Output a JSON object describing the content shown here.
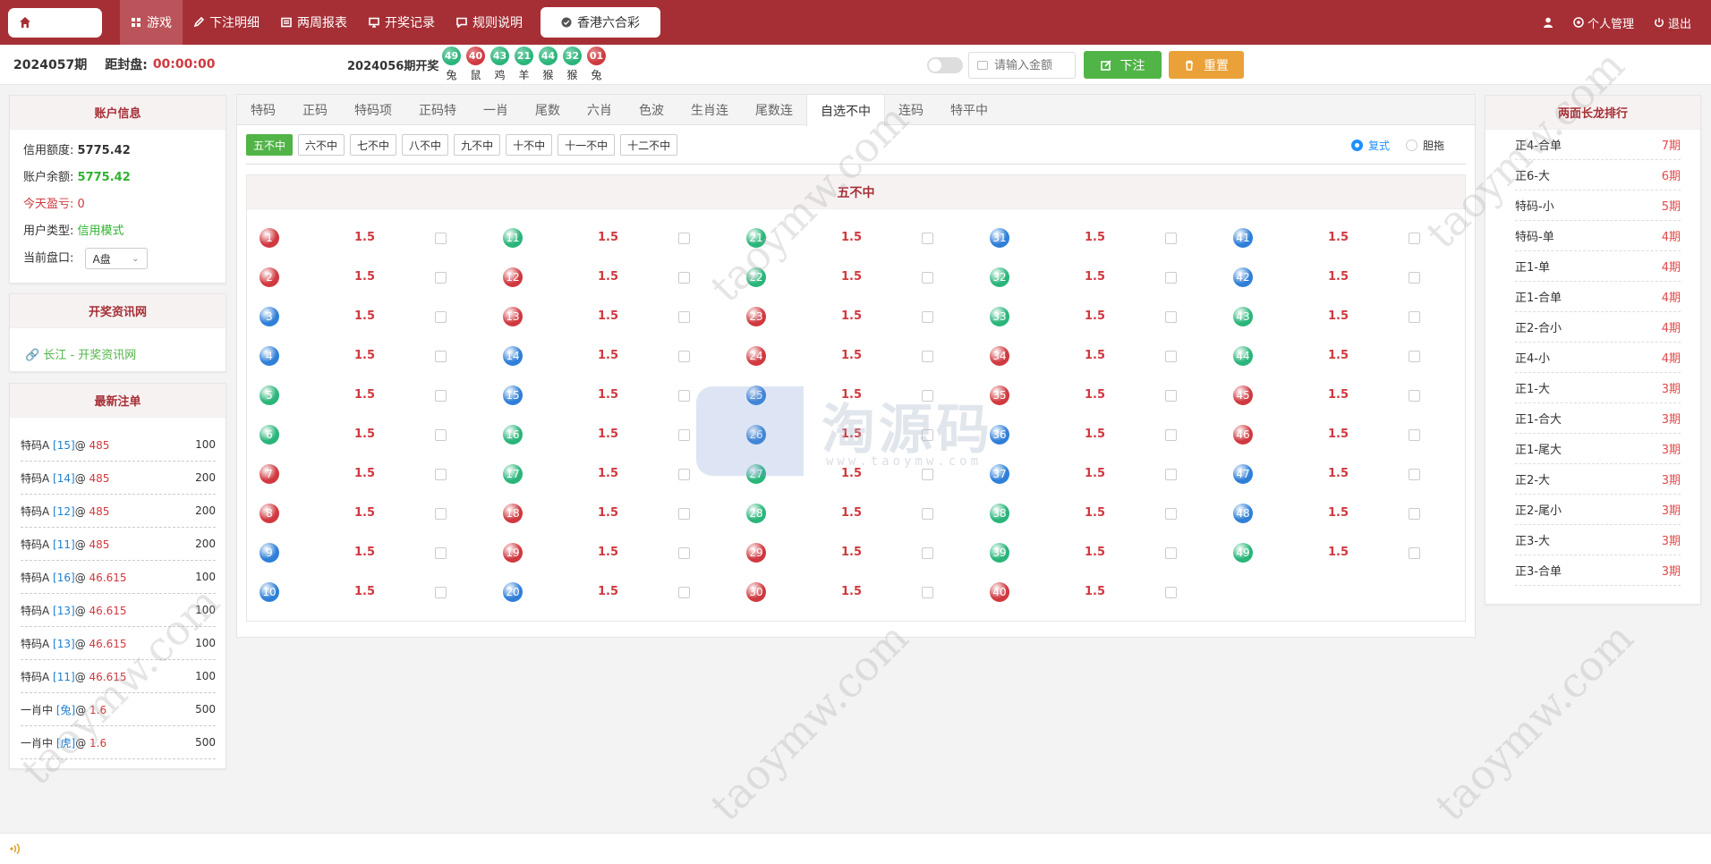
{
  "nav": {
    "items": [
      {
        "label": "游戏",
        "icon": "grid-icon",
        "active": true
      },
      {
        "label": "下注明细",
        "icon": "edit-icon"
      },
      {
        "label": "两周报表",
        "icon": "list-icon"
      },
      {
        "label": "开奖记录",
        "icon": "monitor-icon"
      },
      {
        "label": "规则说明",
        "icon": "message-icon"
      }
    ],
    "lottery": "香港六合彩",
    "user_menu": "个人管理",
    "logout": "退出"
  },
  "infobar": {
    "period": "2024057期",
    "close_label": "距封盘:",
    "close_time": "00:00:00",
    "draw_label": "2024056期开奖",
    "draw_balls": [
      {
        "num": "49",
        "zodiac": "兔",
        "color": "#2ab57a"
      },
      {
        "num": "40",
        "zodiac": "鼠",
        "color": "#d0393f"
      },
      {
        "num": "43",
        "zodiac": "鸡",
        "color": "#2ab57a"
      },
      {
        "num": "21",
        "zodiac": "羊",
        "color": "#2ab57a"
      },
      {
        "num": "44",
        "zodiac": "猴",
        "color": "#2ab57a"
      },
      {
        "num": "32",
        "zodiac": "猴",
        "color": "#2ab57a"
      },
      {
        "num": "01",
        "zodiac": "兔",
        "color": "#d0393f"
      }
    ],
    "amount_placeholder": "请输入金额",
    "bet_button": "下注",
    "reset_button": "重置"
  },
  "account": {
    "title": "账户信息",
    "credit_label": "信用额度:",
    "credit_value": "5775.42",
    "balance_label": "账户余额:",
    "balance_value": "5775.42",
    "profit_label": "今天盈亏:",
    "profit_value": "0",
    "type_label": "用户类型:",
    "type_value": "信用模式",
    "market_label": "当前盘口:",
    "market_value": "A盘"
  },
  "news": {
    "title": "开奖资讯网",
    "link": "长江 - 开奖资讯网"
  },
  "latest": {
    "title": "最新注单",
    "rows": [
      {
        "name": "特码A",
        "sel": "[15]",
        "odds": "485",
        "amount": "100"
      },
      {
        "name": "特码A",
        "sel": "[14]",
        "odds": "485",
        "amount": "200"
      },
      {
        "name": "特码A",
        "sel": "[12]",
        "odds": "485",
        "amount": "200"
      },
      {
        "name": "特码A",
        "sel": "[11]",
        "odds": "485",
        "amount": "200"
      },
      {
        "name": "特码A",
        "sel": "[16]",
        "odds": "46.615",
        "amount": "100"
      },
      {
        "name": "特码A",
        "sel": "[13]",
        "odds": "46.615",
        "amount": "100"
      },
      {
        "name": "特码A",
        "sel": "[13]",
        "odds": "46.615",
        "amount": "100"
      },
      {
        "name": "特码A",
        "sel": "[11]",
        "odds": "46.615",
        "amount": "100"
      },
      {
        "name": "一肖中",
        "sel": "[兔]",
        "odds": "1.6",
        "amount": "500"
      },
      {
        "name": "一肖中",
        "sel": "[虎]",
        "odds": "1.6",
        "amount": "500"
      }
    ]
  },
  "tabs": [
    "特码",
    "正码",
    "特码项",
    "正码特",
    "一肖",
    "尾数",
    "六肖",
    "色波",
    "生肖连",
    "尾数连",
    "自选不中",
    "连码",
    "特平中"
  ],
  "active_tab": 10,
  "subtabs": [
    "五不中",
    "六不中",
    "七不中",
    "八不中",
    "九不中",
    "十不中",
    "十一不中",
    "十二不中"
  ],
  "active_subtab": 0,
  "radio": {
    "compound": "复式",
    "drag": "胆拖"
  },
  "grid": {
    "title": "五不中",
    "odds": "1.5",
    "colors": {
      "red": "#d0393f",
      "blue": "#2f7fd8",
      "green": "#2ab57a"
    },
    "balls": [
      {
        "n": "1",
        "c": "red"
      },
      {
        "n": "2",
        "c": "red"
      },
      {
        "n": "3",
        "c": "blue"
      },
      {
        "n": "4",
        "c": "blue"
      },
      {
        "n": "5",
        "c": "green"
      },
      {
        "n": "6",
        "c": "green"
      },
      {
        "n": "7",
        "c": "red"
      },
      {
        "n": "8",
        "c": "red"
      },
      {
        "n": "9",
        "c": "blue"
      },
      {
        "n": "10",
        "c": "blue"
      },
      {
        "n": "11",
        "c": "green"
      },
      {
        "n": "12",
        "c": "red"
      },
      {
        "n": "13",
        "c": "red"
      },
      {
        "n": "14",
        "c": "blue"
      },
      {
        "n": "15",
        "c": "blue"
      },
      {
        "n": "16",
        "c": "green"
      },
      {
        "n": "17",
        "c": "green"
      },
      {
        "n": "18",
        "c": "red"
      },
      {
        "n": "19",
        "c": "red"
      },
      {
        "n": "20",
        "c": "blue"
      },
      {
        "n": "21",
        "c": "green"
      },
      {
        "n": "22",
        "c": "green"
      },
      {
        "n": "23",
        "c": "red"
      },
      {
        "n": "24",
        "c": "red"
      },
      {
        "n": "25",
        "c": "blue"
      },
      {
        "n": "26",
        "c": "blue"
      },
      {
        "n": "27",
        "c": "green"
      },
      {
        "n": "28",
        "c": "green"
      },
      {
        "n": "29",
        "c": "red"
      },
      {
        "n": "30",
        "c": "red"
      },
      {
        "n": "31",
        "c": "blue"
      },
      {
        "n": "32",
        "c": "green"
      },
      {
        "n": "33",
        "c": "green"
      },
      {
        "n": "34",
        "c": "red"
      },
      {
        "n": "35",
        "c": "red"
      },
      {
        "n": "36",
        "c": "blue"
      },
      {
        "n": "37",
        "c": "blue"
      },
      {
        "n": "38",
        "c": "green"
      },
      {
        "n": "39",
        "c": "green"
      },
      {
        "n": "40",
        "c": "red"
      },
      {
        "n": "41",
        "c": "blue"
      },
      {
        "n": "42",
        "c": "blue"
      },
      {
        "n": "43",
        "c": "green"
      },
      {
        "n": "44",
        "c": "green"
      },
      {
        "n": "45",
        "c": "red"
      },
      {
        "n": "46",
        "c": "red"
      },
      {
        "n": "47",
        "c": "blue"
      },
      {
        "n": "48",
        "c": "blue"
      },
      {
        "n": "49",
        "c": "green"
      }
    ]
  },
  "dragon": {
    "title": "两面长龙排行",
    "rows": [
      {
        "name": "正4-合单",
        "periods": "7期"
      },
      {
        "name": "正6-大",
        "periods": "6期"
      },
      {
        "name": "特码-小",
        "periods": "5期"
      },
      {
        "name": "特码-单",
        "periods": "4期"
      },
      {
        "name": "正1-单",
        "periods": "4期"
      },
      {
        "name": "正1-合单",
        "periods": "4期"
      },
      {
        "name": "正2-合小",
        "periods": "4期"
      },
      {
        "name": "正4-小",
        "periods": "4期"
      },
      {
        "name": "正1-大",
        "periods": "3期"
      },
      {
        "name": "正1-合大",
        "periods": "3期"
      },
      {
        "name": "正1-尾大",
        "periods": "3期"
      },
      {
        "name": "正2-大",
        "periods": "3期"
      },
      {
        "name": "正2-尾小",
        "periods": "3期"
      },
      {
        "name": "正3-大",
        "periods": "3期"
      },
      {
        "name": "正3-合单",
        "periods": "3期"
      }
    ]
  },
  "watermark": {
    "text": "taoymw.com",
    "logo_cn": "淘源码",
    "logo_url": "www.taoymw.com"
  }
}
